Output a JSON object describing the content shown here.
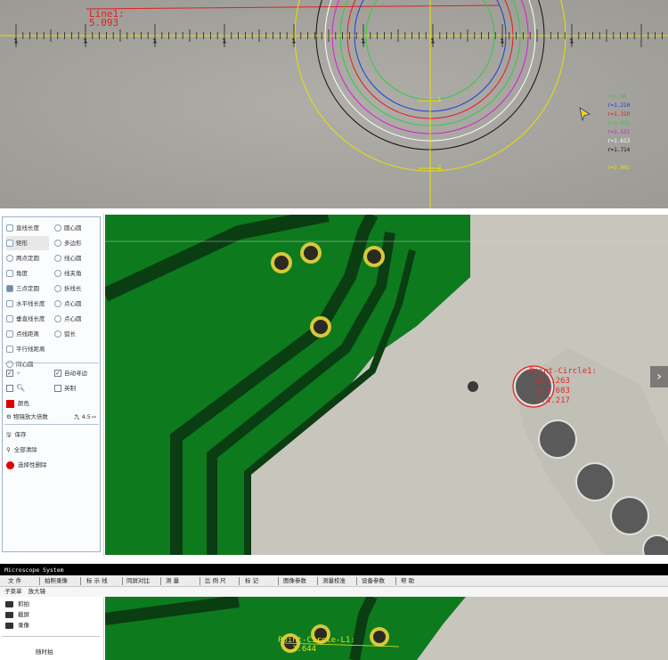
{
  "top_view": {
    "line_label": "Line1:",
    "line_value": "5.093",
    "ruler_numbers": [
      "1",
      "1",
      "1",
      "1",
      "1",
      "1",
      "1",
      "1",
      "1"
    ],
    "circle_marks": [
      "1",
      "2"
    ],
    "radii": [
      {
        "text": "r=1.08",
        "color": "#2ecc40"
      },
      {
        "text": "r=1.210",
        "color": "#1f3bd6"
      },
      {
        "text": "r=1.310",
        "color": "#e21c1c"
      },
      {
        "text": "r=1.411",
        "color": "#2ecc40"
      },
      {
        "text": "r=1.511",
        "color": "#d31fd3"
      },
      {
        "text": "r=1.613",
        "color": "#ffffff"
      },
      {
        "text": "r=1.714",
        "color": "#111111"
      },
      {
        "text": "r=2.001",
        "color": "#e8e000"
      }
    ]
  },
  "tools": {
    "left": [
      "直线长度",
      "矩形",
      "两点定圆",
      "角度",
      "三点定圆",
      "水平线长度",
      "垂直线长度",
      "点线距离",
      "平行线距离",
      "同心圆"
    ],
    "right": [
      "圆心圆",
      "多边形",
      "线心圆",
      "线夹角",
      "折线长",
      "点心圆",
      "点心圆",
      "弧长"
    ],
    "checks": [
      {
        "label": "+",
        "checked": true
      },
      {
        "label": "自动寻边",
        "checked": true
      },
      {
        "label": "",
        "checked": false
      },
      {
        "label": "英制",
        "checked": false
      }
    ],
    "color_label": "颜色",
    "magnification_label": "物镜放大倍数",
    "magnification_value": "九 4.5",
    "save_label": "保存",
    "clear_all_label": "全部清除",
    "clear_selected_label": "选择性删除"
  },
  "middle_view": {
    "circle_title": "Point-Circle1:",
    "values": [
      "D:1.263",
      "R:1.683",
      "C:4.217"
    ],
    "nav_arrow": "›"
  },
  "app": {
    "title": "Microscope System",
    "menus": [
      "文 件",
      "拍照录像",
      "标 示 线",
      "同屏对比",
      "测    量",
      "比 例 尺",
      "标    记",
      "图像参数",
      "测量校准",
      "设备参数",
      "帮    助"
    ],
    "submenus": [
      "子菜单",
      "放大镜"
    ],
    "side_items": [
      "抓拍",
      "截屏",
      "录像"
    ],
    "side_footer": "随时拍",
    "bottom_label": "Point-Circle-L1:",
    "bottom_value": "1.644"
  },
  "colors": {
    "pcb_green": "#0d7a1e",
    "pcb_dark": "#0a3d12",
    "metal": "#c8c6bc",
    "measure_red": "#e02020",
    "pad_yellow": "#d8c83a"
  }
}
